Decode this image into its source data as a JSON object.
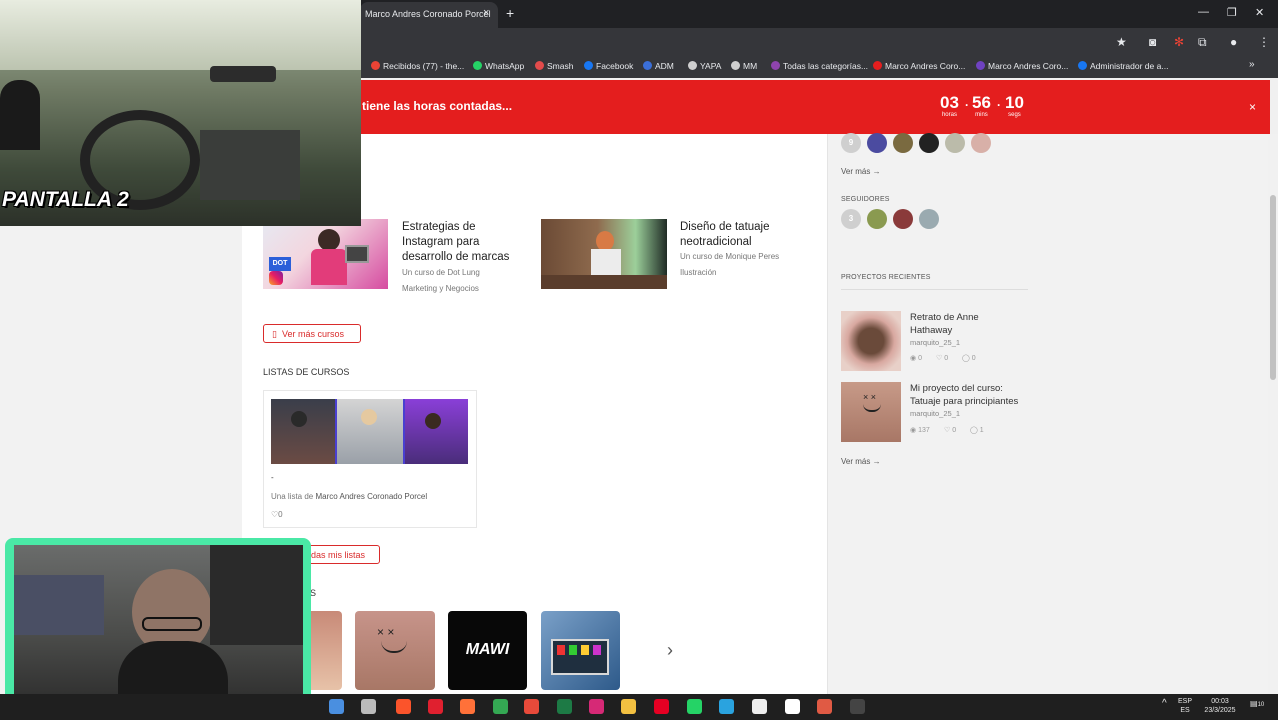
{
  "browser": {
    "tab_title": "Marco Andres Coronado Porcel",
    "tab_close": "×",
    "new_tab": "+",
    "bookmarks": [
      {
        "label": "Recibidos (77) - the...",
        "color": "#ea4335"
      },
      {
        "label": "WhatsApp",
        "color": "#25d366"
      },
      {
        "label": "Smash",
        "color": "#e24b4b"
      },
      {
        "label": "Facebook",
        "color": "#1877f2"
      },
      {
        "label": "ADM",
        "color": "#3b6fd8"
      },
      {
        "label": "YAPA",
        "color": "#cfcfcf"
      },
      {
        "label": "MM",
        "color": "#cfcfcf"
      },
      {
        "label": "Todas las categorías...",
        "color": "#8e44ad"
      },
      {
        "label": "Marco Andres Coro...",
        "color": "#e41e1e"
      },
      {
        "label": "Marco Andres Coro...",
        "color": "#6f42c1"
      },
      {
        "label": "Administrador de a...",
        "color": "#1877f2"
      }
    ],
    "more_bookmarks": "»"
  },
  "banner": {
    "text": "tiene las horas contadas...",
    "hours": "03",
    "hours_label": "horas",
    "mins": "56",
    "mins_label": "mins",
    "secs": "10",
    "secs_label": "segs",
    "close": "×",
    "color": "#e41e1e"
  },
  "courses": [
    {
      "title_lines": [
        "Estrategias de",
        "Instagram para",
        "desarrollo de marcas"
      ],
      "author": "Un curso de Dot Lung",
      "category": "Marketing y Negocios"
    },
    {
      "title_lines": [
        "Diseño de tatuaje",
        "neotradicional"
      ],
      "author": "Un curso de Monique Peres",
      "category": "Ilustración"
    }
  ],
  "more_courses_button": "Ver más cursos",
  "lists_section": {
    "heading": "LISTAS DE CURSOS",
    "card_title": "-",
    "card_owner_prefix": "Una lista de",
    "card_owner": "Marco Andres Coronado Porcel",
    "likes": "0",
    "all_lists_button": "das mis listas"
  },
  "sidebar": {
    "following_count": "9",
    "see_more_1": "Ver más →",
    "followers_heading": "SEGUIDORES",
    "followers_count": "3",
    "recent_projects_heading": "PROYECTOS RECIENTES",
    "projects": [
      {
        "title_lines": [
          "Retrato de Anne",
          "Hathaway"
        ],
        "user": "marquito_25_1",
        "views": "0",
        "likes": "0",
        "comments": "0"
      },
      {
        "title_lines": [
          "Mi proyecto del curso:",
          "Tatuaje para principiantes"
        ],
        "user": "marquito_25_1",
        "views": "137",
        "likes": "0",
        "comments": "1"
      }
    ],
    "see_more_2": "Ver más →"
  },
  "gallery": {
    "partial_heading": "S",
    "logo_text": "MAWI",
    "next_arrow": "›"
  },
  "overlay": {
    "camera_label": "PANTALLA 2"
  },
  "taskbar": {
    "lang_top": "ESP",
    "lang_bottom": "ES",
    "time": "00:03",
    "date": "23/3/2025",
    "notifications": "10"
  }
}
